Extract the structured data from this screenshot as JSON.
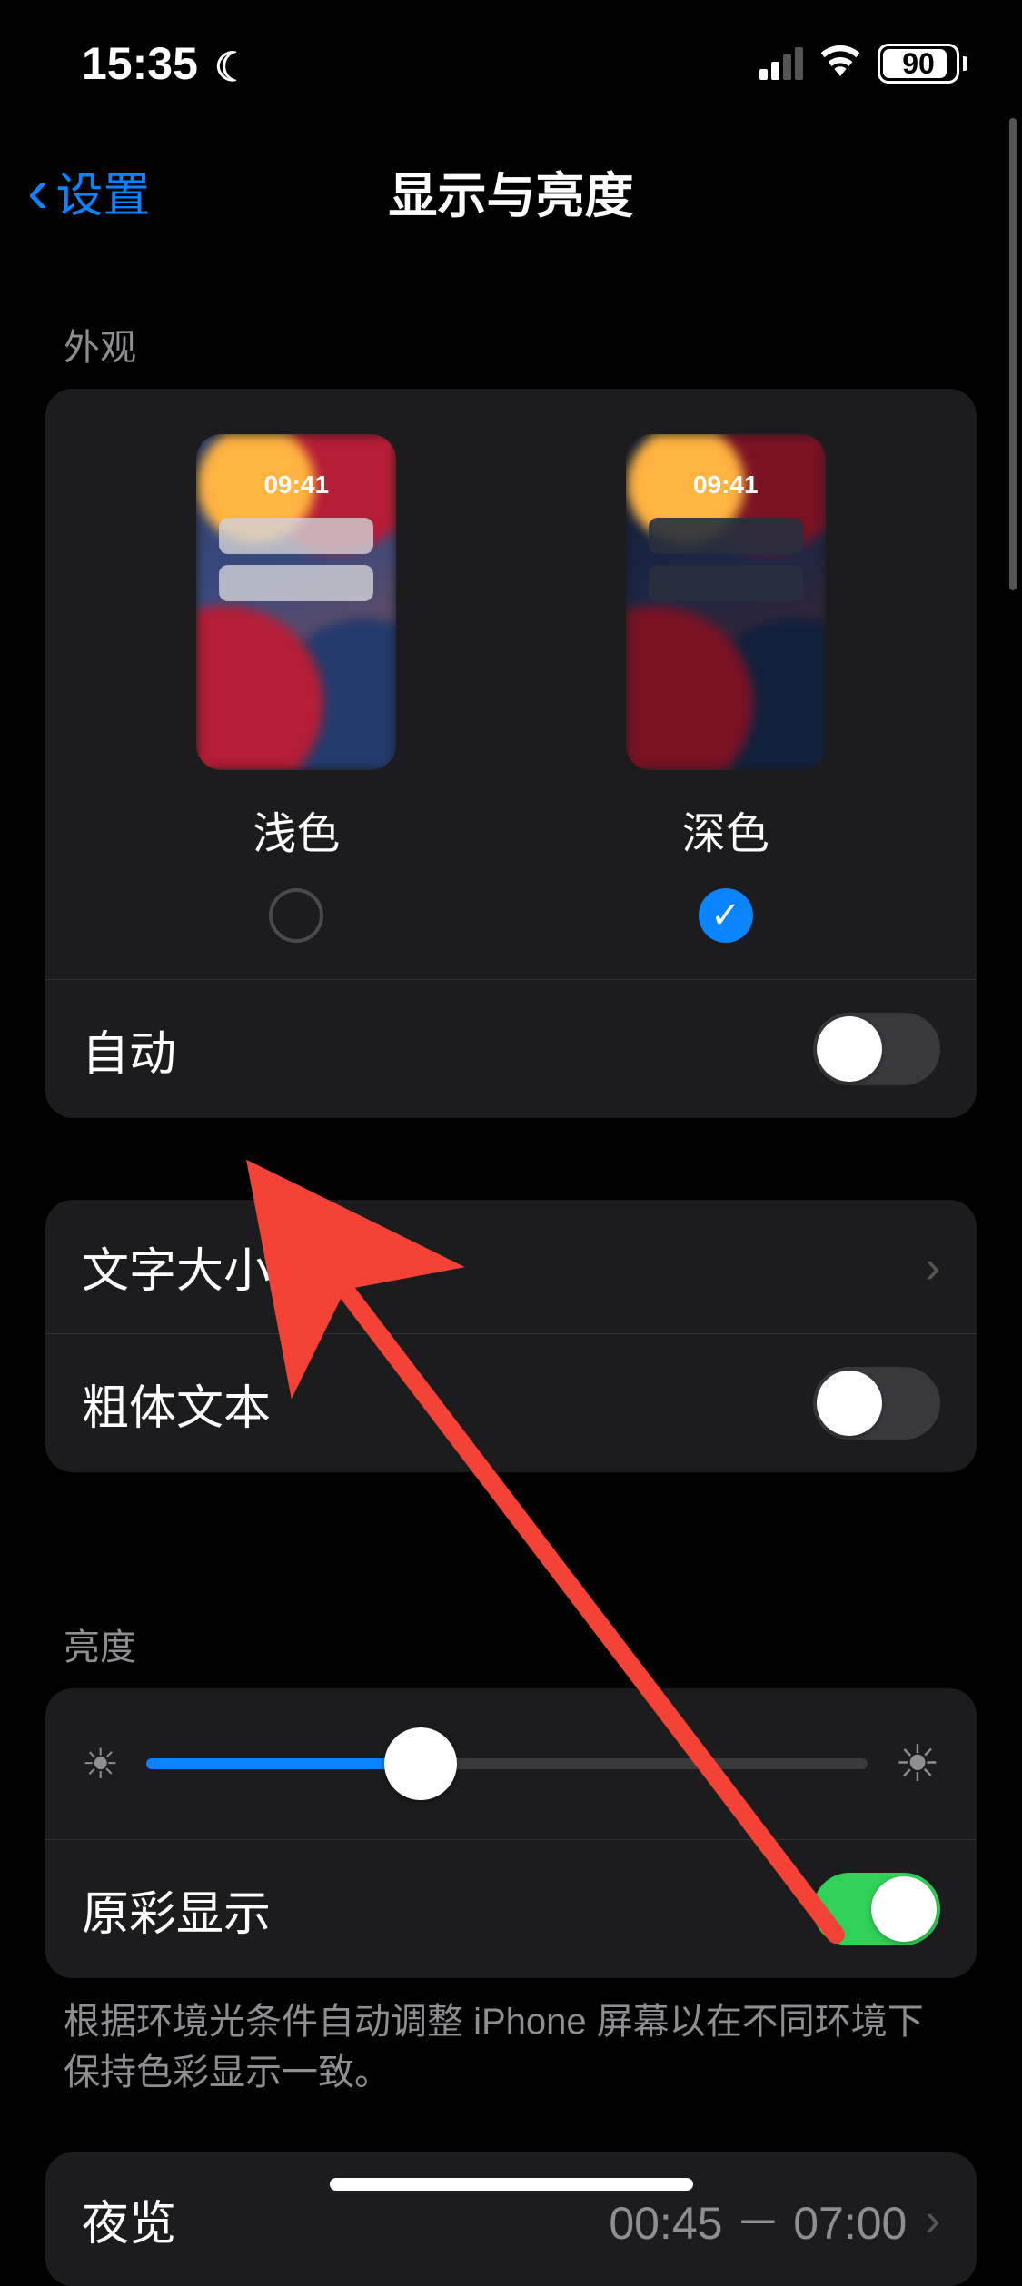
{
  "status_bar": {
    "time": "15:35",
    "focus_mode_icon": "moon-icon",
    "cellular_bars_active": 2,
    "cellular_bars_total": 4,
    "wifi_icon": "wifi-icon",
    "battery_percent": "90"
  },
  "nav": {
    "back_label": "设置",
    "title": "显示与亮度"
  },
  "appearance": {
    "header": "外观",
    "preview_time": "09:41",
    "options": [
      {
        "label": "浅色",
        "selected": false
      },
      {
        "label": "深色",
        "selected": true
      }
    ],
    "auto_label": "自动",
    "auto_on": false
  },
  "text": {
    "text_size_label": "文字大小",
    "bold_text_label": "粗体文本",
    "bold_text_on": false
  },
  "brightness": {
    "header": "亮度",
    "value_percent": 38,
    "true_tone_label": "原彩显示",
    "true_tone_on": true,
    "footer": "根据环境光条件自动调整 iPhone 屏幕以在不同环境下保持色彩显示一致。"
  },
  "night_shift": {
    "label": "夜览",
    "schedule": "00:45 － 07:00"
  },
  "colors": {
    "accent_blue": "#0a84ff",
    "accent_green": "#30d158",
    "annotation_red": "#f44336"
  }
}
